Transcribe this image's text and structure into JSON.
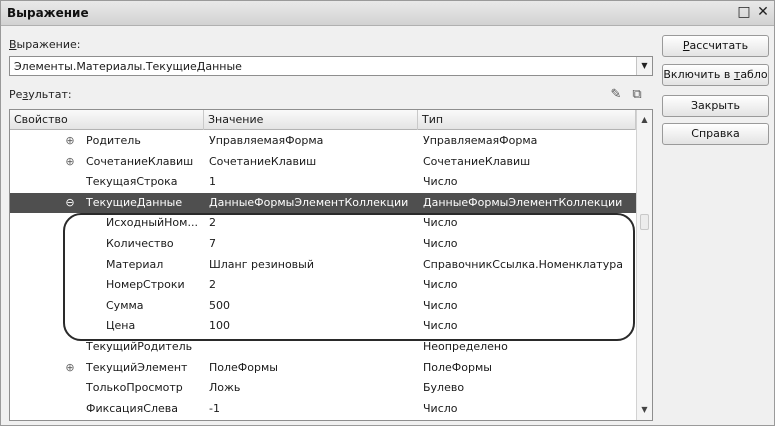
{
  "window": {
    "title": "Выражение",
    "restore_glyph": "□",
    "close_glyph": "✕"
  },
  "expression": {
    "label_first": "В",
    "label_rest": "ыражение:",
    "value": "Элементы.Материалы.ТекущиеДанные"
  },
  "result": {
    "label_start": "Ре",
    "label_underlined": "з",
    "label_end": "ультат:"
  },
  "toolbar": {
    "edit_icon": "pencil-icon",
    "copy_icon": "copy-icon"
  },
  "grid": {
    "columns": [
      "Свойство",
      "Значение",
      "Тип"
    ],
    "rows": [
      {
        "expander": "⊕",
        "property": "Родитель",
        "value": "УправляемаяФорма",
        "type": "УправляемаяФорма"
      },
      {
        "expander": "⊕",
        "property": "СочетаниеКлавиш",
        "value": "СочетаниеКлавиш",
        "type": "СочетаниеКлавиш"
      },
      {
        "expander": "",
        "property": "ТекущаяСтрока",
        "value": "1",
        "type": "Число"
      },
      {
        "expander": "⊖",
        "property": "ТекущиеДанные",
        "value": "ДанныеФормыЭлементКоллекции",
        "type": "ДанныеФормыЭлементКоллекции"
      },
      {
        "expander": "",
        "property": "ИсходныйНом...",
        "value": "2",
        "type": "Число"
      },
      {
        "expander": "",
        "property": "Количество",
        "value": "7",
        "type": "Число"
      },
      {
        "expander": "",
        "property": "Материал",
        "value": "Шланг резиновый",
        "type": "СправочникСсылка.Номенклатура"
      },
      {
        "expander": "",
        "property": "НомерСтроки",
        "value": "2",
        "type": "Число"
      },
      {
        "expander": "",
        "property": "Сумма",
        "value": "500",
        "type": "Число"
      },
      {
        "expander": "",
        "property": "Цена",
        "value": "100",
        "type": "Число"
      },
      {
        "expander": "",
        "property": "ТекущийРодитель",
        "value": "",
        "type": "Неопределено"
      },
      {
        "expander": "⊕",
        "property": "ТекущийЭлемент",
        "value": "ПолеФормы",
        "type": "ПолеФормы"
      },
      {
        "expander": "",
        "property": "ТолькоПросмотр",
        "value": "Ложь",
        "type": "Булево"
      },
      {
        "expander": "",
        "property": "ФиксацияСлева",
        "value": "-1",
        "type": "Число"
      }
    ],
    "selected_row_index": 3
  },
  "buttons": {
    "calculate_underlined": "Р",
    "calculate_rest": "ассчитать",
    "insert_start": "Включить в ",
    "insert_underlined": "т",
    "insert_end": "абло",
    "close": "Закрыть",
    "help": "Справка"
  },
  "colors": {
    "selected_row": "#4f4f4f",
    "window_bg": "#f0f0f0"
  }
}
